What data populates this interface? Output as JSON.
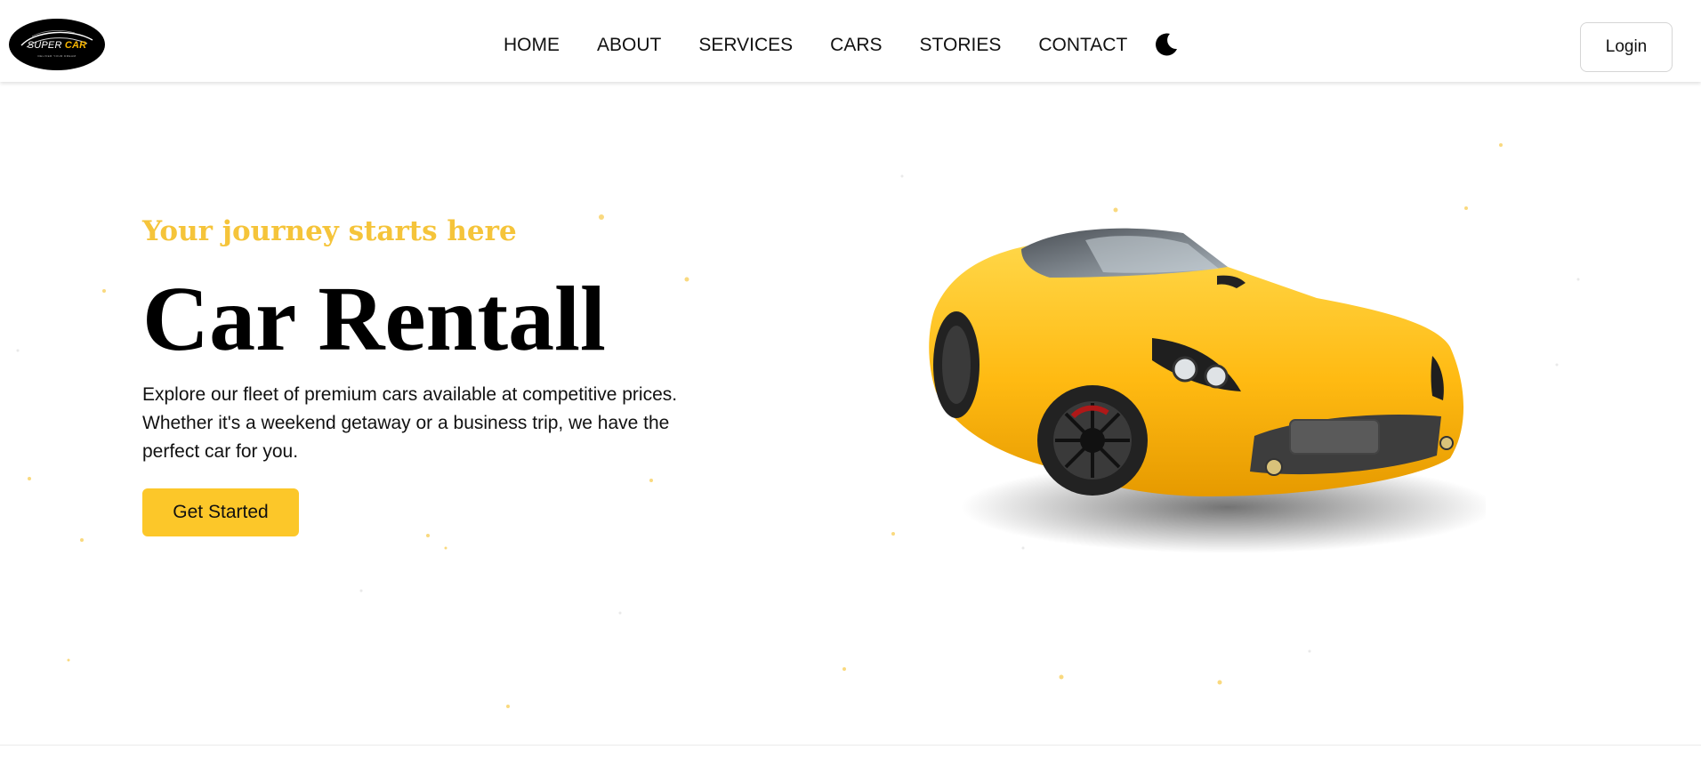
{
  "brand": {
    "logo_text_prefix": "SUPER ",
    "logo_text_accent": "CAR",
    "logo_tagline": "DELIVER YOUR DREAM"
  },
  "nav": {
    "links": [
      "HOME",
      "ABOUT",
      "SERVICES",
      "CARS",
      "STORIES",
      "CONTACT"
    ],
    "theme_toggle_icon": "moon-icon",
    "login_label": "Login"
  },
  "hero": {
    "tagline": "Your journey starts here",
    "title": "Car Rentall",
    "description": "Explore our fleet of premium cars available at competitive prices. Whether it's a weekend getaway or a business trip, we have the perfect car for you.",
    "cta_label": "Get Started",
    "image": "yellow-sports-car"
  },
  "colors": {
    "accent": "#f5c43a",
    "button": "#fcc729",
    "car_body": "#f7b500",
    "text": "#111111"
  }
}
